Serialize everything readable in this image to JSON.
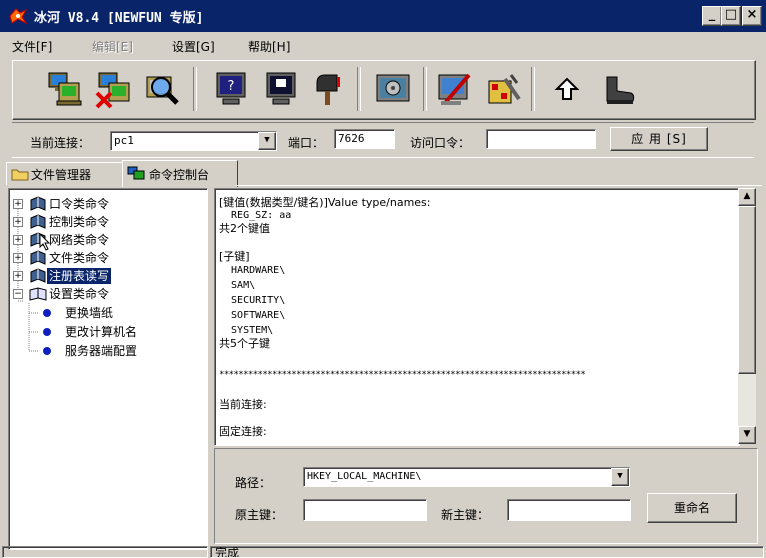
{
  "window": {
    "title": "冰河 V8.4 [NEWFUN 专版]",
    "controls": {
      "minimize": "_",
      "maximize": "□",
      "close": "×"
    }
  },
  "menu": [
    {
      "label": "文件[F]",
      "enabled": true
    },
    {
      "label": "编辑[E]",
      "enabled": false
    },
    {
      "label": "设置[G]",
      "enabled": true
    },
    {
      "label": "帮助[H]",
      "enabled": true
    }
  ],
  "toolbar": {
    "icons": [
      "add-host-icon",
      "delete-host-icon",
      "search-host-icon",
      "help-screen-icon",
      "screen-capture-icon",
      "mailbox-icon",
      "settings-icon",
      "config-server-icon",
      "tools-icon",
      "back-icon",
      "exit-boot-icon"
    ]
  },
  "connection": {
    "current_label": "当前连接：",
    "current_value": "pc1",
    "port_label": "端口：",
    "port_value": "7626",
    "password_label": "访问口令：",
    "password_value": "",
    "apply_label": "应 用 [S]"
  },
  "tabs": [
    {
      "label": "文件管理器",
      "active": false
    },
    {
      "label": "命令控制台",
      "active": true
    }
  ],
  "tree": {
    "items": [
      {
        "label": "口令类命令",
        "expanded": false,
        "selected": false
      },
      {
        "label": "控制类命令",
        "expanded": false,
        "selected": false
      },
      {
        "label": "网络类命令",
        "expanded": false,
        "selected": false
      },
      {
        "label": "文件类命令",
        "expanded": false,
        "selected": false
      },
      {
        "label": "注册表读写",
        "expanded": false,
        "selected": true
      },
      {
        "label": "设置类命令",
        "expanded": true,
        "selected": false
      }
    ],
    "children": [
      "更换墙纸",
      "更改计算机名",
      "服务器端配置"
    ]
  },
  "output": {
    "lines": [
      "[键值(数据类型/键名)]Value type/names:",
      "  REG_SZ: aa",
      "共2个键值",
      "",
      "[子键]",
      "  HARDWARE\\",
      "  SAM\\",
      "  SECURITY\\",
      "  SOFTWARE\\",
      "  SYSTEM\\",
      "共5个子键",
      "",
      "****************************************************************************",
      "",
      "当前连接:",
      "",
      "固定连接:"
    ]
  },
  "registry": {
    "path_label": "路径：",
    "path_value": "HKEY_LOCAL_MACHINE\\",
    "old_key_label": "原主键：",
    "old_key_value": "",
    "new_key_label": "新主键：",
    "new_key_value": "",
    "rename_label": "重命名"
  },
  "status": {
    "text": "完成"
  },
  "colors": {
    "titlebar": "#0a246a",
    "selection": "#0a246a",
    "face": "#d4d0c8"
  }
}
